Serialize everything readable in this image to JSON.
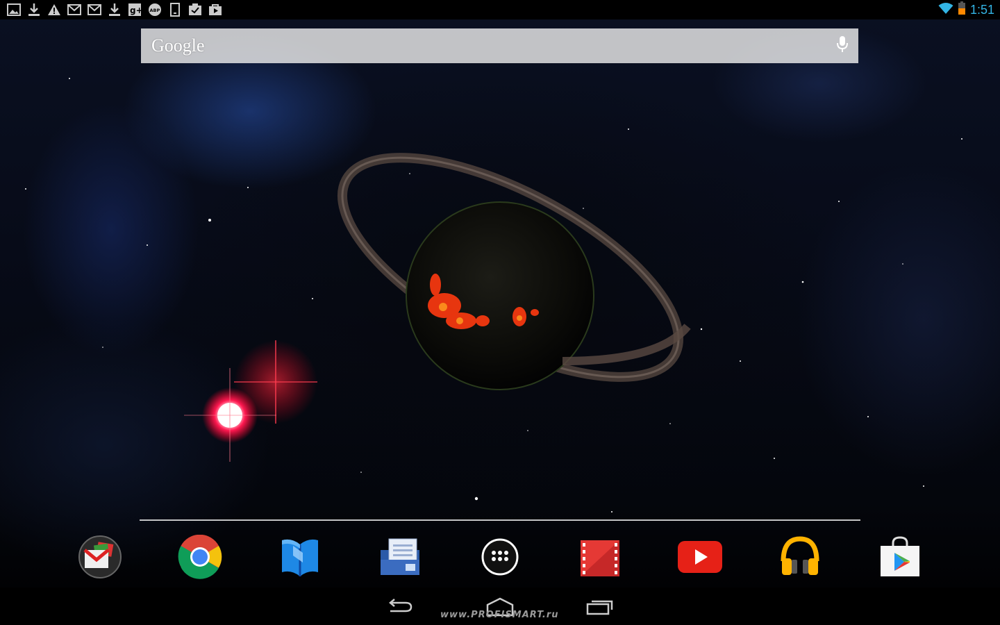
{
  "status_bar": {
    "notification_icons": [
      "image-icon",
      "download-icon",
      "warning-icon",
      "gmail-icon",
      "gmail-icon",
      "download-icon",
      "google-plus-icon",
      "adblock-icon",
      "device-icon",
      "clipboard-check-icon",
      "play-store-bag-icon"
    ],
    "clock": "1:51",
    "clock_color": "#33b5e5",
    "battery_color": "#ff8800"
  },
  "search": {
    "logo_text": "Google"
  },
  "dock": {
    "apps": [
      "gmail",
      "chrome",
      "play-books",
      "docs",
      "app-drawer",
      "play-movies",
      "youtube",
      "play-music",
      "play-store"
    ]
  },
  "nav": {
    "buttons": [
      "back",
      "home",
      "recents"
    ]
  },
  "watermark": "www.PROFISMART.ru"
}
